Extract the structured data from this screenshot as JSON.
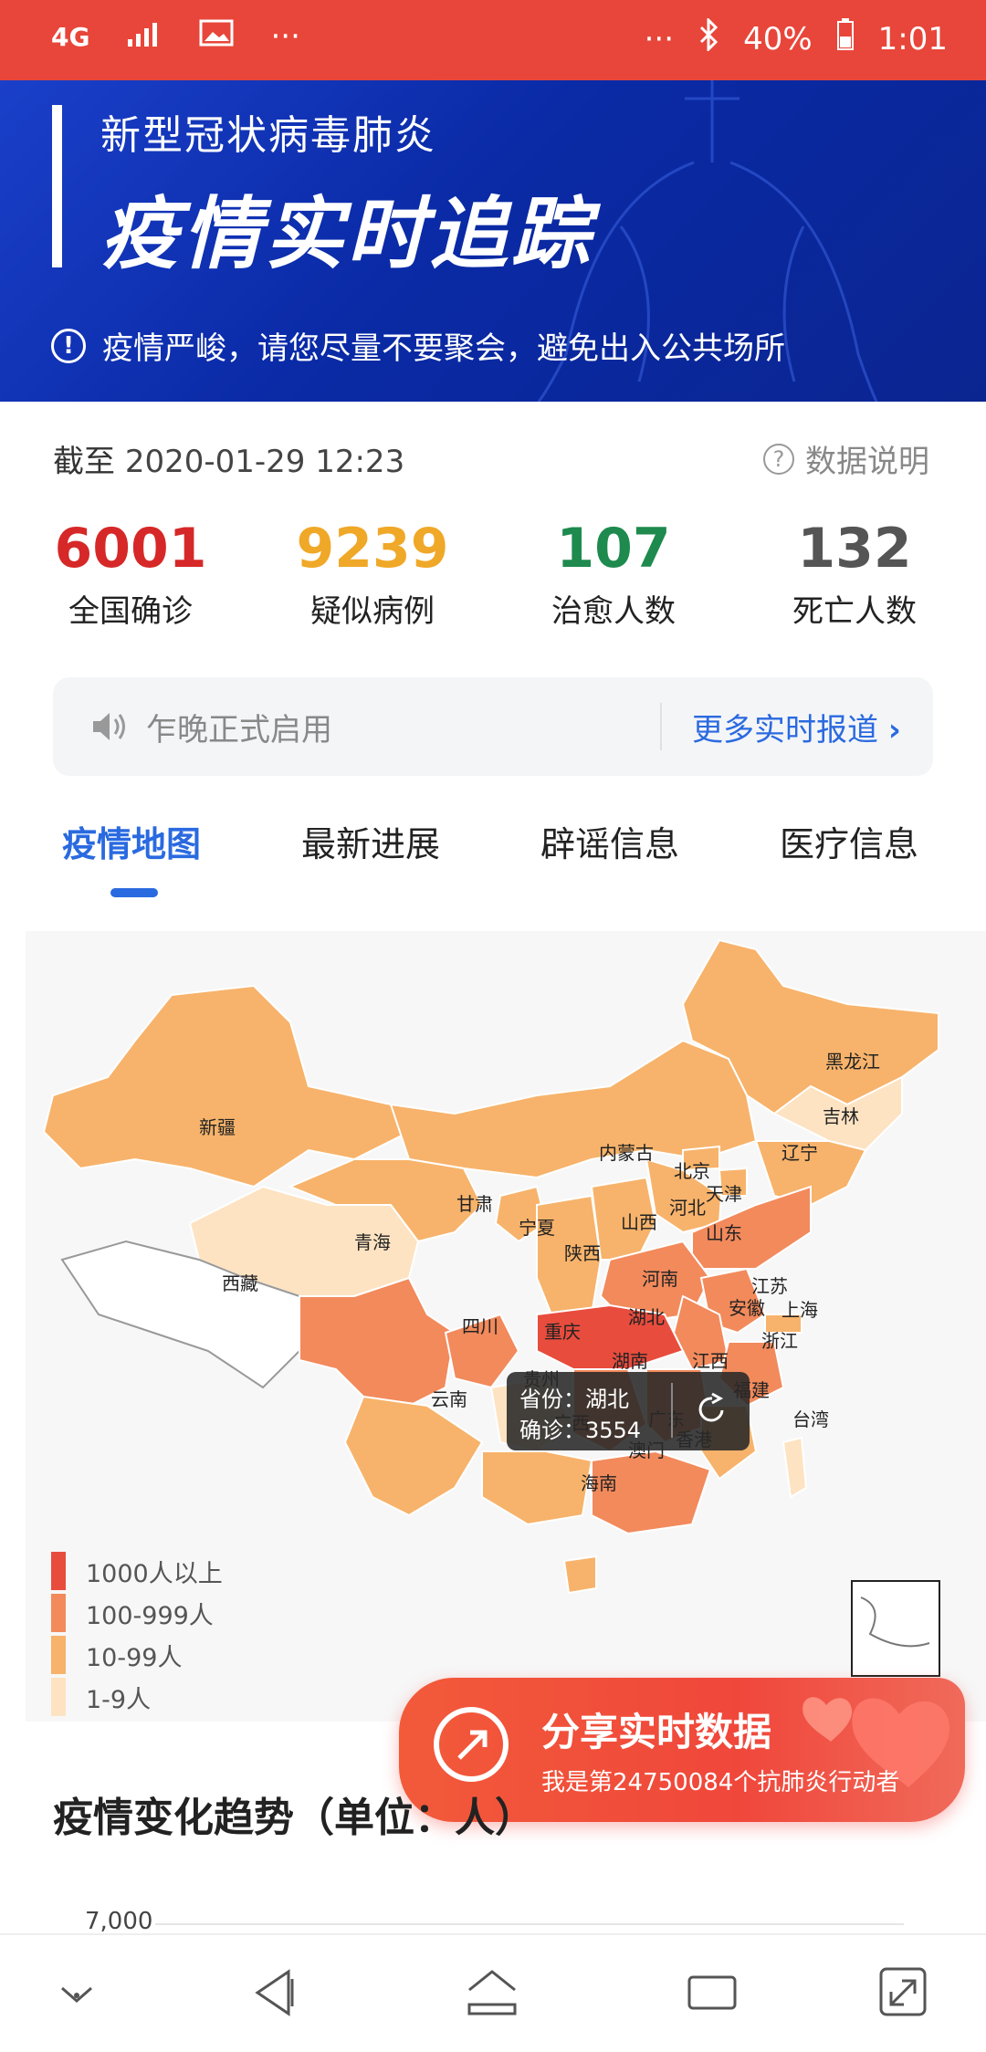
{
  "status_bar": {
    "network": "4G",
    "battery": "40%",
    "time": "1:01",
    "dots": "···"
  },
  "banner": {
    "subtitle": "新型冠状病毒肺炎",
    "title": "疫情实时追踪",
    "notice": "疫情严峻，请您尽量不要聚会，避免出入公共场所"
  },
  "meta": {
    "as_of_label": "截至",
    "as_of_value": "2020-01-29 12:23",
    "help_label": "数据说明"
  },
  "stats": [
    {
      "value": "6001",
      "label": "全国确诊",
      "color": "#d62828"
    },
    {
      "value": "9239",
      "label": "疑似病例",
      "color": "#f0a828"
    },
    {
      "value": "107",
      "label": "治愈人数",
      "color": "#1e8a4e"
    },
    {
      "value": "132",
      "label": "死亡人数",
      "color": "#555555"
    }
  ],
  "news_bar": {
    "text": "乍晚正式启用",
    "more_label": "更多实时报道"
  },
  "tabs": [
    {
      "label": "疫情地图",
      "active": true
    },
    {
      "label": "最新进展",
      "active": false
    },
    {
      "label": "辟谣信息",
      "active": false
    },
    {
      "label": "医疗信息",
      "active": false
    }
  ],
  "map": {
    "labels": [
      "黑龙江",
      "吉林",
      "辽宁",
      "新疆",
      "内蒙古",
      "北京",
      "天津",
      "河北",
      "甘肃",
      "宁夏",
      "山西",
      "山东",
      "青海",
      "陕西",
      "河南",
      "西藏",
      "江苏",
      "安徽",
      "上海",
      "四川",
      "重庆",
      "湖北",
      "浙江",
      "湖南",
      "江西",
      "贵州",
      "云南",
      "福建",
      "台湾",
      "广西",
      "广东",
      "香港",
      "澳门",
      "海南"
    ],
    "tooltip": {
      "province_label": "省份：湖北",
      "confirmed_label": "确诊：3554"
    },
    "legend": [
      {
        "label": "1000人以上",
        "color": "#e84c3d"
      },
      {
        "label": "100-999人",
        "color": "#f28a5c"
      },
      {
        "label": "10-99人",
        "color": "#f7b36b"
      },
      {
        "label": "1-9人",
        "color": "#fde3c2"
      }
    ]
  },
  "share": {
    "title": "分享实时数据",
    "subtitle": "我是第24750084个抗肺炎行动者"
  },
  "trend": {
    "title": "疫情变化趋势（单位：人）",
    "axis_top": "7,000"
  },
  "nav": [
    "down-icon",
    "back-icon",
    "home-icon",
    "recents-icon",
    "expand-icon"
  ]
}
